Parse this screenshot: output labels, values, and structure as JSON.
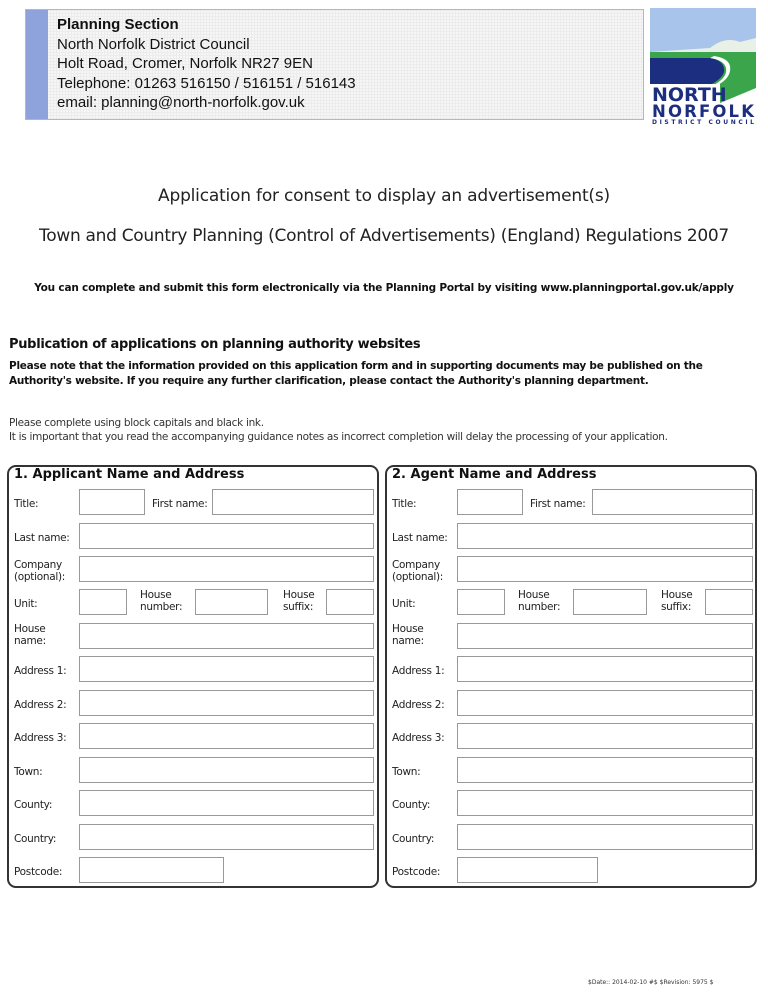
{
  "header": {
    "org_title": "Planning Section",
    "lines": [
      "North Norfolk District Council",
      "Holt Road, Cromer, Norfolk  NR27 9EN",
      "Telephone: 01263  516150 / 516151 / 516143",
      "email:  planning@north-norfolk.gov.uk"
    ],
    "logo": {
      "line1": "NORTH",
      "line2": "NORFOLK",
      "line3": "DISTRICT COUNCIL",
      "colors": {
        "sky": "#a9c4ea",
        "land": "#3aa54a",
        "sea": "#1c2e7f",
        "text": "#1c2e7f"
      }
    }
  },
  "title": "Application for consent to display an advertisement(s)",
  "subtitle": "Town and Country Planning (Control of Advertisements) (England) Regulations 2007",
  "portal_note": "You can complete and submit this form electronically via the Planning Portal by visiting www.planningportal.gov.uk/apply",
  "publication": {
    "heading": "Publication of applications on planning authority websites",
    "text_line1": "Please note that the information provided on this application form and in supporting documents may be published on the",
    "text_line2": "Authority's website. If you require any further clarification, please contact the Authority's planning department."
  },
  "instructions": {
    "line1": "Please complete using block capitals and black ink.",
    "line2": "It is important that you read the accompanying guidance notes as incorrect completion will delay the  processing of your application."
  },
  "sections": [
    {
      "title": "1.  Applicant Name and Address",
      "labels": {
        "title": "Title:",
        "first_name": "First name:",
        "last_name": "Last name:",
        "company_1": "Company",
        "company_2": "(optional):",
        "unit": "Unit:",
        "house_number_1": "House",
        "house_number_2": "number:",
        "house_suffix_1": "House",
        "house_suffix_2": "suffix:",
        "house_name_1": "House",
        "house_name_2": "name:",
        "address1": "Address 1:",
        "address2": "Address 2:",
        "address3": "Address 3:",
        "town": "Town:",
        "county": "County:",
        "country": "Country:",
        "postcode": "Postcode:"
      },
      "values": {
        "title": "",
        "first_name": "",
        "last_name": "",
        "company": "",
        "unit": "",
        "house_number": "",
        "house_suffix": "",
        "house_name": "",
        "address1": "",
        "address2": "",
        "address3": "",
        "town": "",
        "county": "",
        "country": "",
        "postcode": ""
      }
    },
    {
      "title": "2.  Agent Name and Address",
      "labels": {
        "title": "Title:",
        "first_name": "First name:",
        "last_name": "Last name:",
        "company_1": "Company",
        "company_2": "(optional):",
        "unit": "Unit:",
        "house_number_1": "House",
        "house_number_2": "number:",
        "house_suffix_1": "House",
        "house_suffix_2": "suffix:",
        "house_name_1": "House",
        "house_name_2": "name:",
        "address1": "Address 1:",
        "address2": "Address 2:",
        "address3": "Address 3:",
        "town": "Town:",
        "county": "County:",
        "country": "Country:",
        "postcode": "Postcode:"
      },
      "values": {
        "title": "",
        "first_name": "",
        "last_name": "",
        "company": "",
        "unit": "",
        "house_number": "",
        "house_suffix": "",
        "house_name": "",
        "address1": "",
        "address2": "",
        "address3": "",
        "town": "",
        "county": "",
        "country": "",
        "postcode": ""
      }
    }
  ],
  "footer": "$Date:: 2014-02-10 #$ $Revision: 5975 $"
}
